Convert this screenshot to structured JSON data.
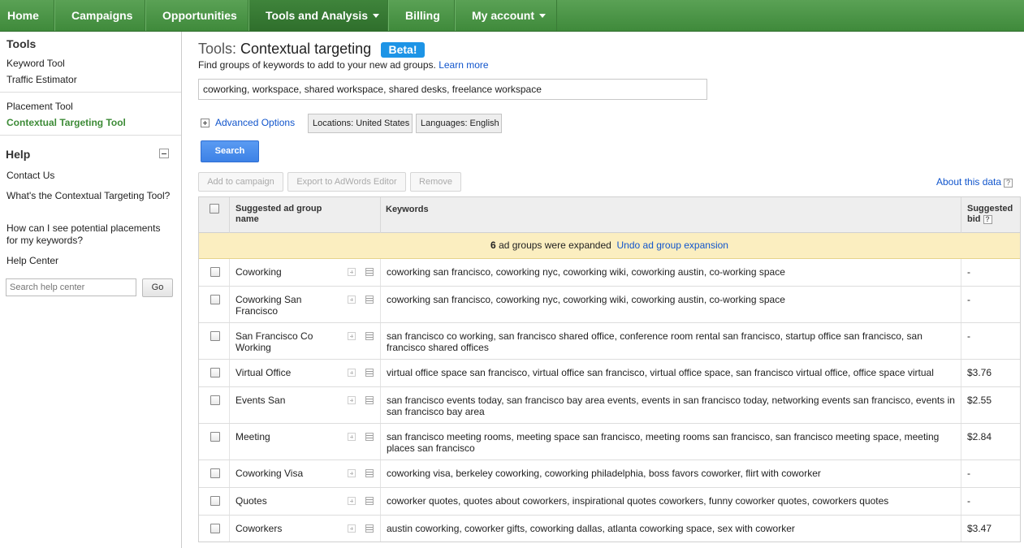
{
  "nav": {
    "items": [
      {
        "label": "Home"
      },
      {
        "label": "Campaigns"
      },
      {
        "label": "Opportunities"
      },
      {
        "label": "Tools and Analysis"
      },
      {
        "label": "Billing"
      },
      {
        "label": "My account"
      }
    ]
  },
  "sidebar": {
    "tools_heading": "Tools",
    "keyword_tool": "Keyword Tool",
    "traffic_estimator": "Traffic Estimator",
    "placement_tool": "Placement Tool",
    "contextual_tool": "Contextual Targeting Tool",
    "help_heading": "Help",
    "contact_us": "Contact Us",
    "faq1": "What's the Contextual Targeting Tool?",
    "faq2": "How can I see potential placements for my keywords?",
    "help_center": "Help Center",
    "search_placeholder": "Search help center",
    "go_label": "Go"
  },
  "main": {
    "title_prefix": "Tools:",
    "title": "Contextual targeting",
    "beta": "Beta!",
    "subtitle": "Find groups of keywords to add to your new ad groups.",
    "learn_more": "Learn more",
    "keywords_value": "coworking, workspace, shared workspace, shared desks, freelance workspace",
    "advanced_options": "Advanced Options",
    "locations_chip": "Locations: United States",
    "languages_chip": "Languages: English",
    "search_label": "Search",
    "add_to_campaign": "Add to campaign",
    "export_label": "Export to AdWords Editor",
    "remove_label": "Remove",
    "about_data": "About this data",
    "help_glyph": "?"
  },
  "table": {
    "col_name": "Suggested ad group name",
    "col_keywords": "Keywords",
    "col_bid": "Suggested bid",
    "banner_count": "6",
    "banner_text": "ad groups were expanded",
    "banner_undo": "Undo ad group expansion",
    "rows": [
      {
        "name": "Coworking",
        "keywords": "coworking san francisco, coworking nyc, coworking wiki, coworking austin, co-working space",
        "bid": "-"
      },
      {
        "name": "Coworking San Francisco",
        "keywords": "coworking san francisco, coworking nyc, coworking wiki, coworking austin, co-working space",
        "bid": "-"
      },
      {
        "name": "San Francisco Co Working",
        "keywords": "san francisco co working, san francisco shared office, conference room rental san francisco, startup office san francisco, san francisco shared offices",
        "bid": "-"
      },
      {
        "name": "Virtual Office",
        "keywords": "virtual office space san francisco, virtual office san francisco, virtual office space, san francisco virtual office, office space virtual",
        "bid": "$3.76"
      },
      {
        "name": "Events San",
        "keywords": "san francisco events today, san francisco bay area events, events in san francisco today, networking events san francisco, events in san francisco bay area",
        "bid": "$2.55"
      },
      {
        "name": "Meeting",
        "keywords": "san francisco meeting rooms, meeting space san francisco, meeting rooms san francisco, san francisco meeting space, meeting places san francisco",
        "bid": "$2.84"
      },
      {
        "name": "Coworking Visa",
        "keywords": "coworking visa, berkeley coworking, coworking philadelphia, boss favors coworker, flirt with coworker",
        "bid": "-"
      },
      {
        "name": "Quotes",
        "keywords": "coworker quotes, quotes about coworkers, inspirational quotes coworkers, funny coworker quotes, coworkers quotes",
        "bid": "-"
      },
      {
        "name": "Coworkers",
        "keywords": "austin coworking, coworker gifts, coworking dallas, atlanta coworking space, sex with coworker",
        "bid": "$3.47"
      }
    ]
  }
}
